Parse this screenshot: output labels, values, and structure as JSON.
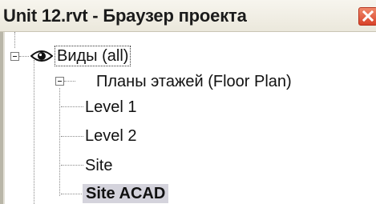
{
  "window": {
    "title": "Unit 12.rvt - Браузер проекта",
    "close_glyph": "✕"
  },
  "tree": {
    "root": {
      "label": "Виды (all)",
      "icon": "eye-icon",
      "expanded": true
    },
    "group": {
      "label": "Планы этажей (Floor Plan)",
      "expanded": true
    },
    "items": [
      {
        "label": "Level 1",
        "selected": false
      },
      {
        "label": "Level 2",
        "selected": false
      },
      {
        "label": "Site",
        "selected": false
      },
      {
        "label": "Site ACAD",
        "selected": true
      }
    ]
  },
  "colors": {
    "selection": "#d4d3dc",
    "close_button": "#d8432a"
  }
}
